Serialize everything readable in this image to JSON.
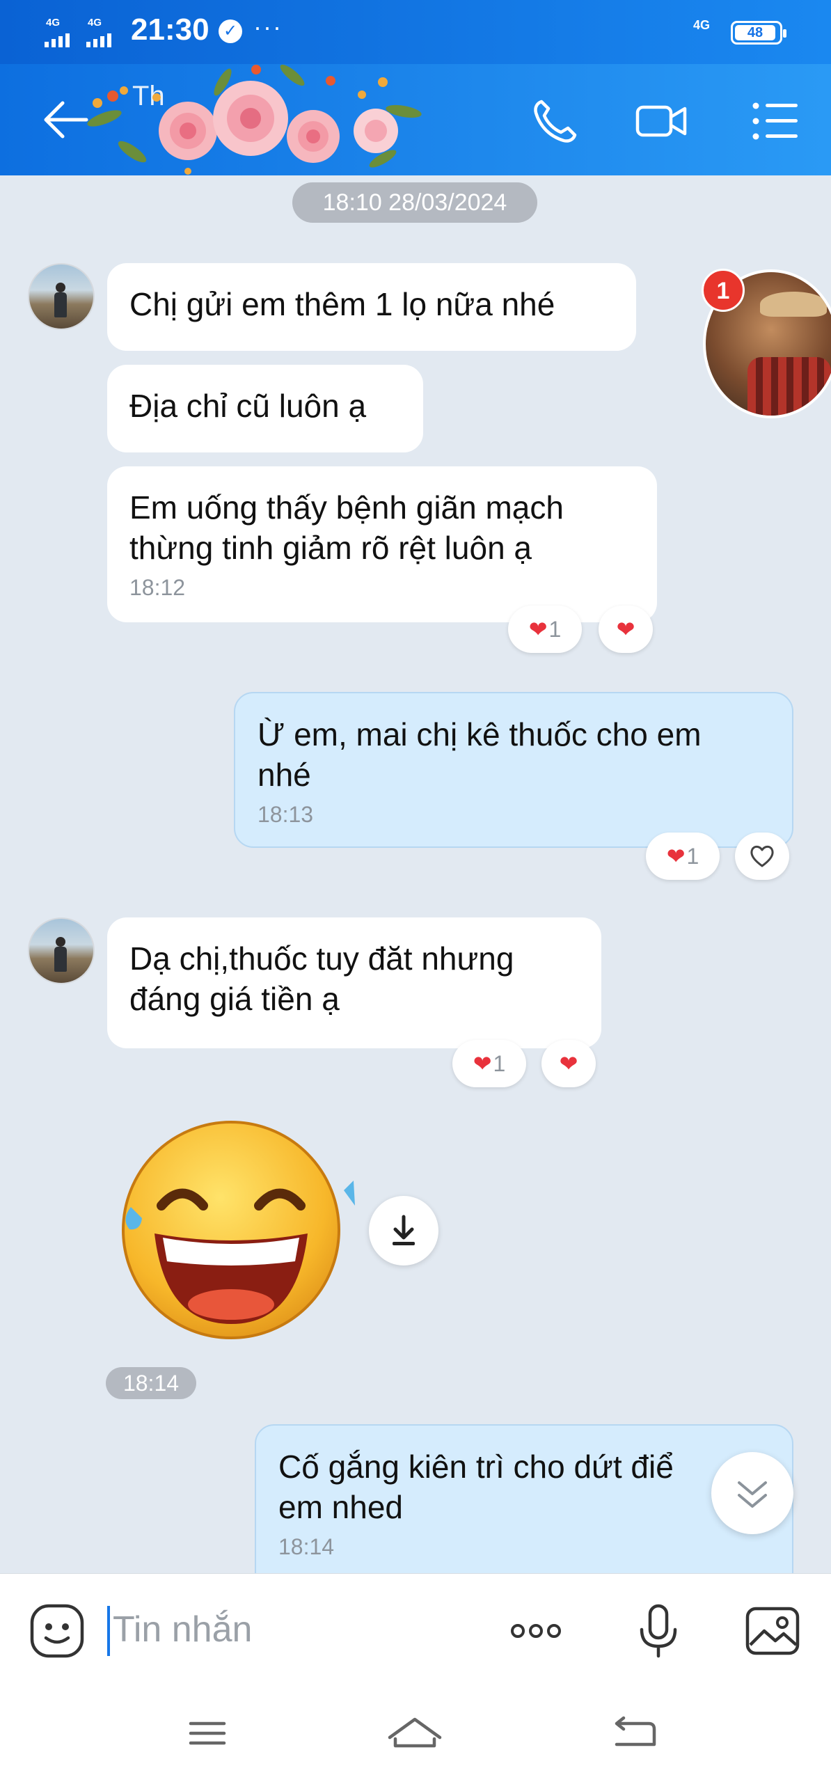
{
  "status_bar": {
    "network_left_1": "4G",
    "network_left_2": "4G",
    "time": "21:30",
    "more": "···",
    "network_right": "4G",
    "battery": "48"
  },
  "header": {
    "title": "Th",
    "icons": [
      "back-arrow-icon",
      "phone-icon",
      "video-camera-icon",
      "menu-list-icon"
    ]
  },
  "chat": {
    "date_separator": "18:10 28/03/2024",
    "unread_badge": "1",
    "messages": [
      {
        "from": "other",
        "text": "Chị gửi em thêm 1 lọ nữa nhé"
      },
      {
        "from": "other",
        "text": "Địa chỉ cũ luôn ạ"
      },
      {
        "from": "other",
        "line1": "Em uống thấy bệnh giãn mạch",
        "line2": "thừng tinh giảm rõ rệt luôn ạ",
        "time": "18:12",
        "reaction_count": "1"
      },
      {
        "from": "me",
        "line1": "Ừ em, mai chị kê thuốc cho em",
        "line2": "nhé",
        "time": "18:13",
        "reaction_count": "1"
      },
      {
        "from": "other",
        "line1": "Dạ chị,thuốc tuy đăt nhưng",
        "line2": "đáng giá tiền ạ",
        "reaction_count": "1"
      },
      {
        "from": "other",
        "type": "sticker",
        "sticker_icon": "laughing-tears-emoji-icon",
        "time": "18:14"
      },
      {
        "from": "me",
        "line1": "Cố gắng kiên trì cho dứt điể",
        "line2": "em nhed",
        "time": "18:14"
      }
    ]
  },
  "input": {
    "placeholder": "Tin nhắn",
    "icons": [
      "emoji-icon",
      "more-options-icon",
      "microphone-icon",
      "gallery-icon"
    ]
  },
  "nav": {
    "icons": [
      "nav-menu-icon",
      "nav-home-icon",
      "nav-back-icon"
    ]
  },
  "colors": {
    "header_blue": "#1a88f0",
    "chat_background": "#e2e9f1",
    "outgoing_bubble": "#d5ecfd",
    "heart_red": "#e8323c",
    "badge_red": "#e8352c"
  }
}
